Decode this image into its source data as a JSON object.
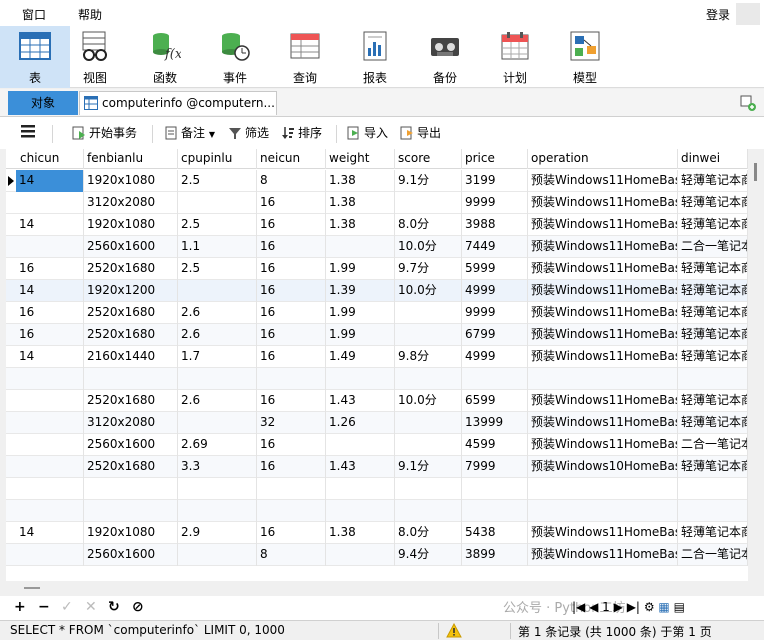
{
  "menu": {
    "items": [
      "窗口",
      "帮助"
    ],
    "login": "登录"
  },
  "ribbon": [
    {
      "label": "表",
      "icon": "table-icon",
      "active": true
    },
    {
      "label": "视图",
      "icon": "view-glasses-icon",
      "active": false
    },
    {
      "label": "函数",
      "icon": "function-icon",
      "active": false
    },
    {
      "label": "事件",
      "icon": "event-clock-icon",
      "active": false
    },
    {
      "label": "查询",
      "icon": "query-icon",
      "active": false
    },
    {
      "label": "报表",
      "icon": "report-icon",
      "active": false
    },
    {
      "label": "备份",
      "icon": "backup-icon",
      "active": false
    },
    {
      "label": "计划",
      "icon": "schedule-icon",
      "active": false
    },
    {
      "label": "模型",
      "icon": "model-icon",
      "active": false
    }
  ],
  "tabs": {
    "objects": "对象",
    "table_tab": "computerinfo @computern..."
  },
  "toolbar": {
    "begin_tx": "开始事务",
    "note": "备注",
    "filter": "筛选",
    "sort": "排序",
    "import": "导入",
    "export": "导出"
  },
  "columns": [
    "chicun",
    "fenbianlu",
    "cpupinlu",
    "neicun",
    "weight",
    "score",
    "price",
    "operation",
    "dinwei"
  ],
  "rows": [
    [
      "14",
      "1920x1080",
      "2.5",
      "8",
      "1.38",
      "9.1分",
      "3199",
      "预装Windows11HomeBas",
      "轻薄笔记本商"
    ],
    [
      "",
      "3120x2080",
      "",
      "16",
      "1.38",
      "",
      "9999",
      "预装Windows11HomeBas",
      "轻薄笔记本商"
    ],
    [
      "14",
      "1920x1080",
      "2.5",
      "16",
      "1.38",
      "8.0分",
      "3988",
      "预装Windows11HomeBas",
      "轻薄笔记本商"
    ],
    [
      "",
      "2560x1600",
      "1.1",
      "16",
      "",
      "10.0分",
      "7449",
      "预装Windows11HomeBas",
      "二合一笔记本"
    ],
    [
      "16",
      "2520x1680",
      "2.5",
      "16",
      "1.99",
      "9.7分",
      "5999",
      "预装Windows11HomeBas",
      "轻薄笔记本商"
    ],
    [
      "14",
      "1920x1200",
      "",
      "16",
      "1.39",
      "10.0分",
      "4999",
      "预装Windows11HomeBas",
      "轻薄笔记本商"
    ],
    [
      "16",
      "2520x1680",
      "2.6",
      "16",
      "1.99",
      "",
      "9999",
      "预装Windows11HomeBas",
      "轻薄笔记本商"
    ],
    [
      "16",
      "2520x1680",
      "2.6",
      "16",
      "1.99",
      "",
      "6799",
      "预装Windows11HomeBas",
      "轻薄笔记本商"
    ],
    [
      "14",
      "2160x1440",
      "1.7",
      "16",
      "1.49",
      "9.8分",
      "4999",
      "预装Windows11HomeBas",
      "轻薄笔记本商"
    ],
    [
      "",
      "",
      "",
      "",
      "",
      "",
      "",
      "",
      ""
    ],
    [
      "",
      "2520x1680",
      "2.6",
      "16",
      "1.43",
      "10.0分",
      "6599",
      "预装Windows11HomeBas",
      "轻薄笔记本商"
    ],
    [
      "",
      "3120x2080",
      "",
      "32",
      "1.26",
      "",
      "13999",
      "预装Windows11HomeBas",
      "轻薄笔记本商"
    ],
    [
      "",
      "2560x1600",
      "2.69",
      "16",
      "",
      "",
      "4599",
      "预装Windows11HomeBas",
      "二合一笔记本"
    ],
    [
      "",
      "2520x1680",
      "3.3",
      "16",
      "1.43",
      "9.1分",
      "7999",
      "预装Windows10HomeBas",
      "轻薄笔记本商"
    ],
    [
      "",
      "",
      "",
      "",
      "",
      "",
      "",
      "",
      ""
    ],
    [
      "",
      "",
      "",
      "",
      "",
      "",
      "",
      "",
      ""
    ],
    [
      "14",
      "1920x1080",
      "2.9",
      "16",
      "1.38",
      "8.0分",
      "5438",
      "预装Windows11HomeBas",
      "轻薄笔记本商"
    ],
    [
      "",
      "2560x1600",
      "",
      "8",
      "",
      "9.4分",
      "3899",
      "预装Windows11HomeBas",
      "二合一笔记本"
    ]
  ],
  "watermark": "公众号 · Python工坊",
  "pager": {
    "page": "1"
  },
  "status": {
    "sql": "SELECT * FROM `computerinfo` LIMIT 0, 1000",
    "record": "第 1 条记录 (共 1000 条) 于第 1 页"
  }
}
